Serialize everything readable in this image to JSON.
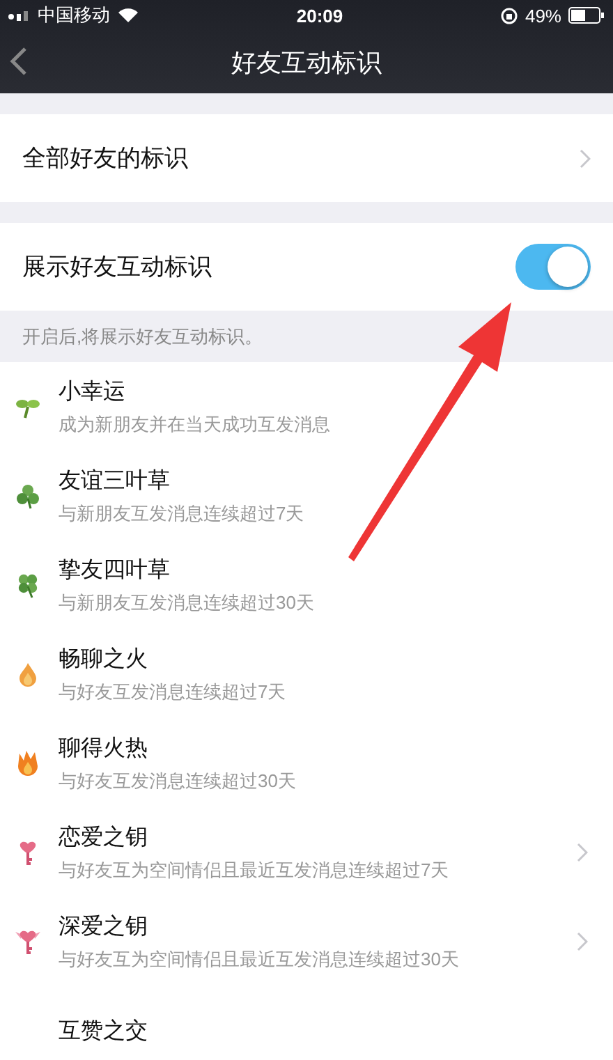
{
  "status_bar": {
    "carrier": "中国移动",
    "time": "20:09",
    "battery": "49%"
  },
  "nav": {
    "title": "好友互动标识"
  },
  "all_marks": {
    "label": "全部好友的标识"
  },
  "show_toggle": {
    "label": "展示好友互动标识",
    "on": true
  },
  "hint": "开启后,将展示好友互动标识。",
  "items": [
    {
      "kind": "sprout",
      "title": "小幸运",
      "subtitle": "成为新朋友并在当天成功互发消息",
      "chevron": false
    },
    {
      "kind": "clover3",
      "title": "友谊三叶草",
      "subtitle": "与新朋友互发消息连续超过7天",
      "chevron": false
    },
    {
      "kind": "clover4",
      "title": "挚友四叶草",
      "subtitle": "与新朋友互发消息连续超过30天",
      "chevron": false
    },
    {
      "kind": "flame",
      "title": "畅聊之火",
      "subtitle": "与好友互发消息连续超过7天",
      "chevron": false
    },
    {
      "kind": "fire",
      "title": "聊得火热",
      "subtitle": "与好友互发消息连续超过30天",
      "chevron": false
    },
    {
      "kind": "key",
      "title": "恋爱之钥",
      "subtitle": "与好友互为空间情侣且最近互发消息连续超过7天",
      "chevron": true
    },
    {
      "kind": "winged_key",
      "title": "深爱之钥",
      "subtitle": "与好友互为空间情侣且最近互发消息连续超过30天",
      "chevron": true
    },
    {
      "kind": "none",
      "title": "互赞之交",
      "chevron": false
    }
  ]
}
